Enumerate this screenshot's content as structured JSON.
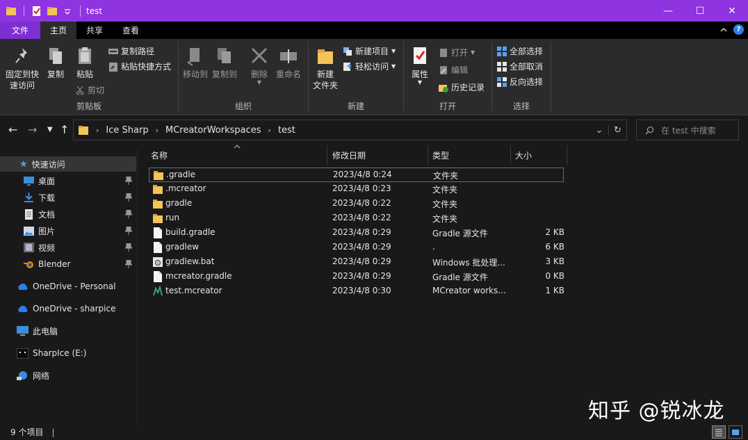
{
  "window": {
    "title": "test",
    "controls": {
      "minimize": "—",
      "maximize": "☐",
      "close": "✕"
    }
  },
  "ribbon_tabs": [
    {
      "label": "文件"
    },
    {
      "label": "主页"
    },
    {
      "label": "共享"
    },
    {
      "label": "查看"
    }
  ],
  "ribbon": {
    "clipboard": {
      "label": "剪贴板",
      "pin_label_1": "固定到快",
      "pin_label_2": "速访问",
      "copy": "复制",
      "paste": "粘贴",
      "copy_path": "复制路径",
      "paste_shortcut": "粘贴快捷方式",
      "cut": "剪切"
    },
    "organize": {
      "label": "组织",
      "move_to": "移动到",
      "copy_to": "复制到",
      "delete": "删除",
      "rename": "重命名"
    },
    "new": {
      "label": "新建",
      "new_folder_1": "新建",
      "new_folder_2": "文件夹",
      "new_item": "新建项目",
      "easy_access": "轻松访问"
    },
    "open": {
      "label": "打开",
      "properties": "属性",
      "open": "打开",
      "edit": "编辑",
      "history": "历史记录"
    },
    "select": {
      "label": "选择",
      "select_all": "全部选择",
      "select_none": "全部取消",
      "invert": "反向选择"
    }
  },
  "address": {
    "crumbs": [
      "Ice Sharp",
      "MCreatorWorkspaces",
      "test"
    ],
    "search_placeholder": "在 test 中搜索"
  },
  "sidebar": {
    "quick_access": "快速访问",
    "pinned": [
      {
        "label": "桌面"
      },
      {
        "label": "下载"
      },
      {
        "label": "文档"
      },
      {
        "label": "图片"
      },
      {
        "label": "视频"
      },
      {
        "label": "Blender"
      }
    ],
    "onedrive_personal": "OneDrive - Personal",
    "onedrive_sharpice": "OneDrive - sharpice",
    "this_pc": "此电脑",
    "drive": "SharpIce (E:)",
    "network": "网络"
  },
  "columns": {
    "name": "名称",
    "modified": "修改日期",
    "type": "类型",
    "size": "大小"
  },
  "files": [
    {
      "name": ".gradle",
      "modified": "2023/4/8 0:24",
      "type": "文件夹",
      "size": "",
      "kind": "folder"
    },
    {
      "name": ".mcreator",
      "modified": "2023/4/8 0:23",
      "type": "文件夹",
      "size": "",
      "kind": "folder"
    },
    {
      "name": "gradle",
      "modified": "2023/4/8 0:22",
      "type": "文件夹",
      "size": "",
      "kind": "folder"
    },
    {
      "name": "run",
      "modified": "2023/4/8 0:22",
      "type": "文件夹",
      "size": "",
      "kind": "folder"
    },
    {
      "name": "build.gradle",
      "modified": "2023/4/8 0:29",
      "type": "Gradle 源文件",
      "size": "2 KB",
      "kind": "doc"
    },
    {
      "name": "gradlew",
      "modified": "2023/4/8 0:29",
      "type": ".",
      "size": "6 KB",
      "kind": "doc"
    },
    {
      "name": "gradlew.bat",
      "modified": "2023/4/8 0:29",
      "type": "Windows 批处理...",
      "size": "3 KB",
      "kind": "bat"
    },
    {
      "name": "mcreator.gradle",
      "modified": "2023/4/8 0:29",
      "type": "Gradle 源文件",
      "size": "0 KB",
      "kind": "doc"
    },
    {
      "name": "test.mcreator",
      "modified": "2023/4/8 0:30",
      "type": "MCreator works...",
      "size": "1 KB",
      "kind": "mcreator"
    }
  ],
  "status": {
    "count": "9 个项目"
  },
  "watermark": "知乎 @锐冰龙",
  "colors": {
    "titlebar": "#8e34e0",
    "file_tab": "#7e2fd4",
    "folder": "#f2c45a",
    "accent_blue": "#2a7ff0"
  }
}
